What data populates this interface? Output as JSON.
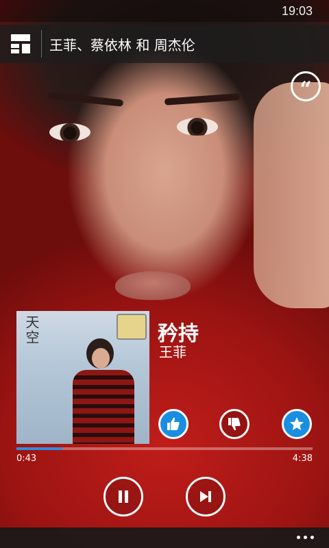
{
  "status": {
    "time": "19:03"
  },
  "header": {
    "artists": "王菲、蔡依林 和 周杰伦"
  },
  "album": {
    "cover_text": "天空"
  },
  "track": {
    "title": "矜持",
    "artist": "王菲",
    "elapsed": "0:43",
    "duration": "4:38",
    "progress_fraction": 0.155
  },
  "icons": {
    "hub": "hub-grid-icon",
    "lyrics": "quote-icon",
    "like": "thumbs-up-icon",
    "dislike": "thumbs-down-icon",
    "favorite": "star-icon",
    "pause": "pause-icon",
    "next": "skip-next-icon",
    "more": "more-icon"
  },
  "colors": {
    "accent": "#1a8ee0",
    "progress": "#2e8ee0"
  }
}
